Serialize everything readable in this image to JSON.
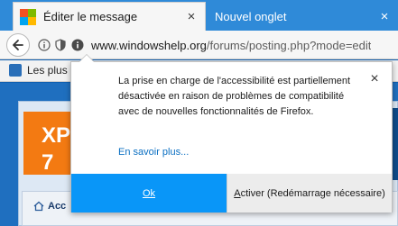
{
  "tabs": [
    {
      "title": "Éditer le message",
      "active": true,
      "close": "×"
    },
    {
      "title": "Nouvel onglet",
      "active": false,
      "close": "×"
    }
  ],
  "navbar": {
    "url_domain": "www.windowshelp.org",
    "url_path": "/forums/posting.php?mode=edit"
  },
  "bookmarks": {
    "first_item": "Les plus"
  },
  "page": {
    "logo_text": "XP\n7",
    "bottom_label": "Acc"
  },
  "popup": {
    "message": "La prise en charge de l'accessibilité est partiellement désactivée en raison de problèmes de compatibilité avec de nouvelles fonctionnalités de Firefox.",
    "link": "En savoir plus...",
    "ok_button": "Ok",
    "restart_first_letter": "A",
    "restart_rest": "ctiver (Redémarrage nécessaire)",
    "close": "×"
  },
  "colors": {
    "tabstrip": "#2f8ad8",
    "ok_button": "#0996f8",
    "link": "#0a6fc2"
  }
}
